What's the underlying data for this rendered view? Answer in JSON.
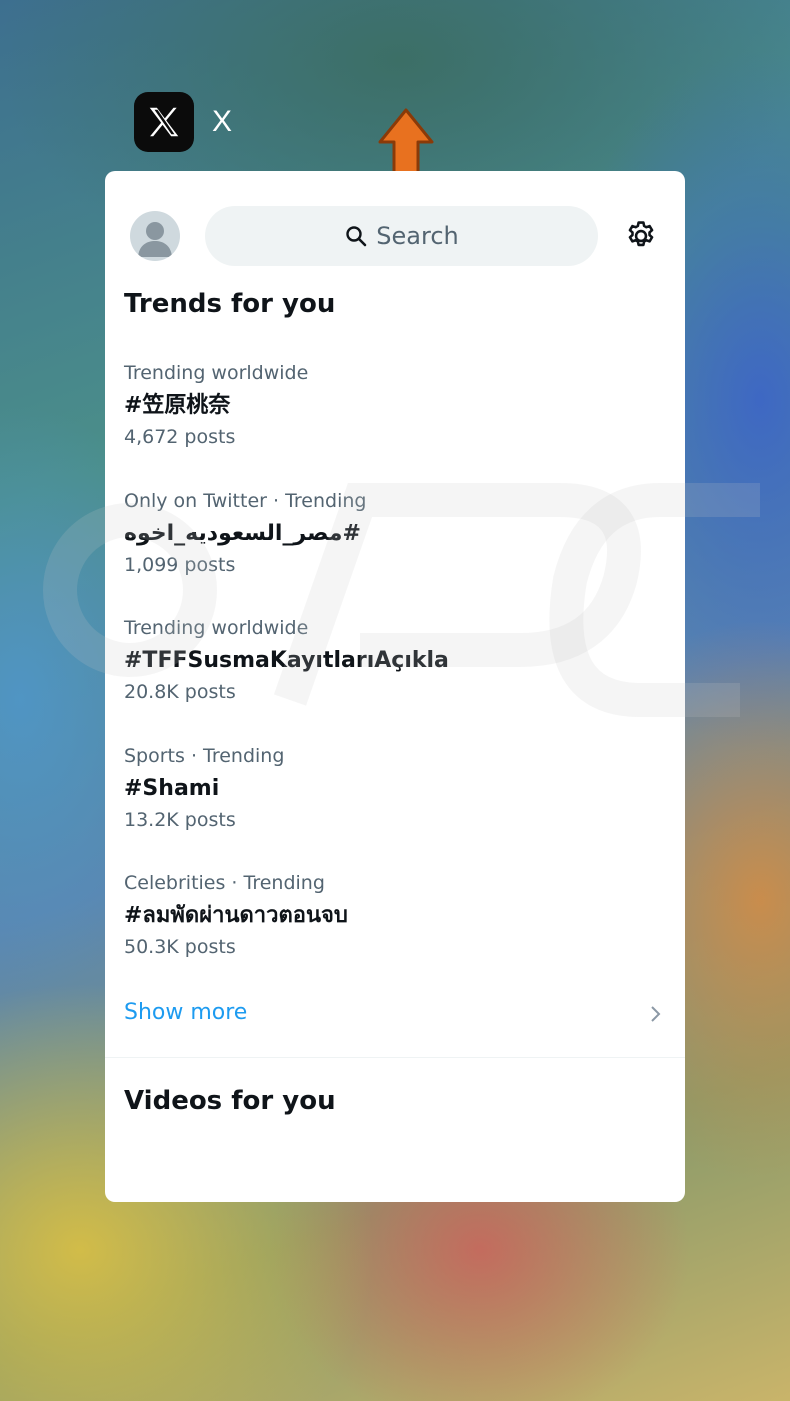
{
  "app": {
    "name": "X",
    "icon": "x-logo-icon"
  },
  "overlay": {
    "arrow_color": "#e8711f",
    "arrow_icon": "arrow-up-icon"
  },
  "header": {
    "avatar_icon": "avatar-placeholder-icon",
    "search_placeholder": "Search",
    "settings_icon": "gear-icon"
  },
  "trends": {
    "title": "Trends for you",
    "items": [
      {
        "meta": "Trending worldwide",
        "name": "#笠原桃奈",
        "count": "4,672 posts"
      },
      {
        "meta": "Only on Twitter · Trending",
        "name": "#مصر_السعوديه_اخوه",
        "count": "1,099 posts"
      },
      {
        "meta": "Trending worldwide",
        "name": "#TFFSusmaKayıtlarıAçıkla",
        "count": "20.8K posts"
      },
      {
        "meta": "Sports · Trending",
        "name": "#Shami",
        "count": "13.2K posts"
      },
      {
        "meta": "Celebrities · Trending",
        "name": "#ลมพัดผ่านดาวตอนจบ",
        "count": "50.3K posts"
      }
    ],
    "show_more": "Show more"
  },
  "videos": {
    "title": "Videos for you"
  },
  "colors": {
    "link": "#1d9bf0",
    "secondary_text": "#536471",
    "primary_text": "#0f1419"
  }
}
